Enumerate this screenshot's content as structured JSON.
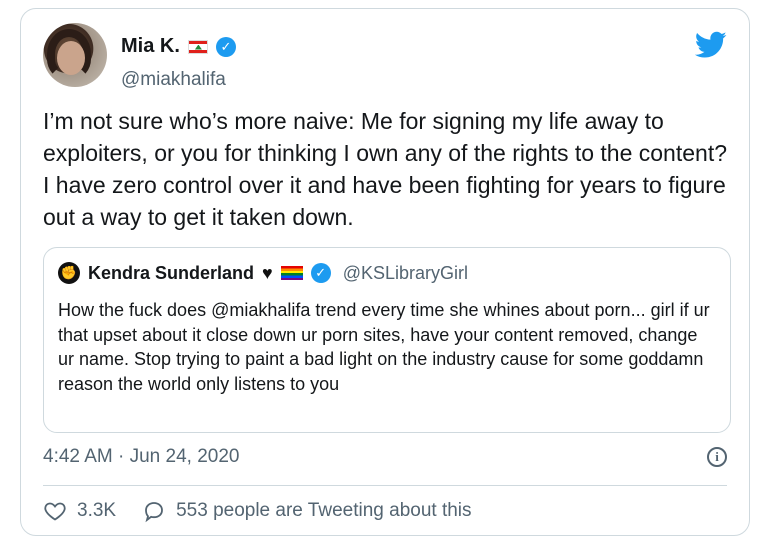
{
  "author": {
    "name": "Mia K.",
    "handle": "@miakhalifa",
    "flag_icon": "lebanon-flag-icon",
    "verified_icon": "verified-badge-icon"
  },
  "tweet": {
    "text": "I’m not sure who’s more naive: Me for signing my life away to exploiters, or you for thinking I own any of the rights to the content? I have zero control over it and have been fighting for years to figure out a way to get it taken down."
  },
  "quoted": {
    "name": "Kendra Sunderland",
    "handle": "@KSLibraryGirl",
    "text": "How the fuck does @miakhalifa trend every time she whines about porn... girl if ur that upset about it close down ur porn sites, have your content removed, change ur name. Stop trying to paint a bad light on the industry cause for some goddamn reason the world only listens to you"
  },
  "meta": {
    "timestamp": "4:42 AM · Jun 24, 2020"
  },
  "actions": {
    "likes": "3.3K",
    "tweeting_about": "553 people are Tweeting about this"
  },
  "colors": {
    "accent": "#1d9bf0",
    "muted": "#536471",
    "border": "#cfd9de"
  }
}
